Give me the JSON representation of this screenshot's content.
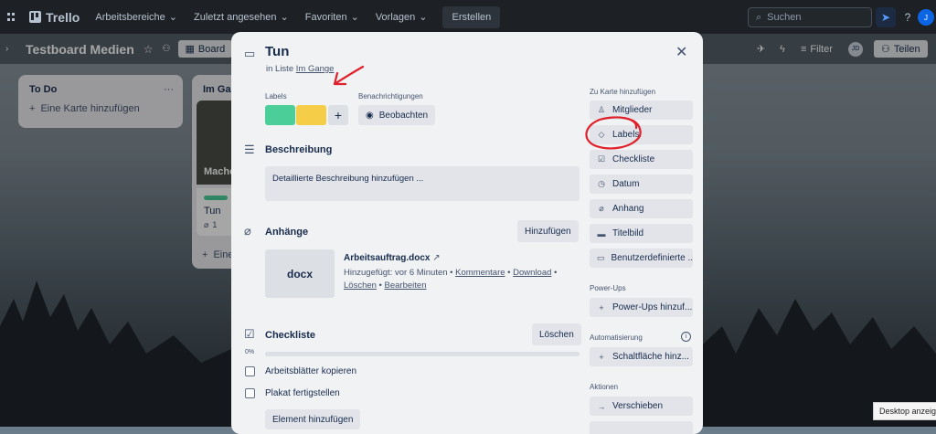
{
  "topbar": {
    "app_name": "Trello",
    "menus": [
      "Arbeitsbereiche",
      "Zuletzt angesehen",
      "Favoriten",
      "Vorlagen"
    ],
    "create_label": "Erstellen",
    "search_placeholder": "Suchen"
  },
  "board": {
    "title": "Testboard Medien",
    "view_label": "Board",
    "filter_label": "Filter",
    "share_label": "Teilen",
    "avatar_initials": "JD"
  },
  "lists": [
    {
      "title": "To Do",
      "add_card": "Eine Karte hinzufügen"
    },
    {
      "title": "Im Gange",
      "cover_text": "Mache",
      "card_title": "Tun",
      "card_count": "1",
      "add_card": "Eine"
    }
  ],
  "modal": {
    "title": "Tun",
    "in_list_prefix": "in Liste",
    "list_name": "Im Gange",
    "labels_heading": "Labels",
    "notifications_heading": "Benachrichtigungen",
    "watch_label": "Beobachten",
    "label_colors": [
      "#4bce97",
      "#f5cd47"
    ],
    "description_heading": "Beschreibung",
    "description_placeholder": "Detaillierte Beschreibung hinzufügen ...",
    "attachments_heading": "Anhänge",
    "attachments_add": "Hinzufügen",
    "attachment": {
      "thumb": "docx",
      "name": "Arbeitsauftrag.docx",
      "added": "Hinzugefügt: vor 6 Minuten",
      "comments": "Kommentare",
      "download": "Download",
      "delete": "Löschen",
      "edit": "Bearbeiten"
    },
    "checklist_heading": "Checkliste",
    "checklist_delete": "Löschen",
    "checklist_progress": "0%",
    "checklist_items": [
      "Arbeitsblätter kopieren",
      "Plakat fertigstellen"
    ],
    "add_item": "Element hinzufügen",
    "sidebar": {
      "add_heading": "Zu Karte hinzufügen",
      "add_buttons": [
        "Mitglieder",
        "Labels",
        "Checkliste",
        "Datum",
        "Anhang",
        "Titelbild",
        "Benutzerdefinierte ..."
      ],
      "powerups_heading": "Power-Ups",
      "powerups_button": "Power-Ups hinzuf...",
      "automation_heading": "Automatisierung",
      "automation_button": "Schaltfläche hinz...",
      "actions_heading": "Aktionen",
      "actions_buttons": [
        "Verschieben"
      ]
    }
  },
  "tooltip": "Desktop anzeigen",
  "annotation_color": "#e0202a"
}
